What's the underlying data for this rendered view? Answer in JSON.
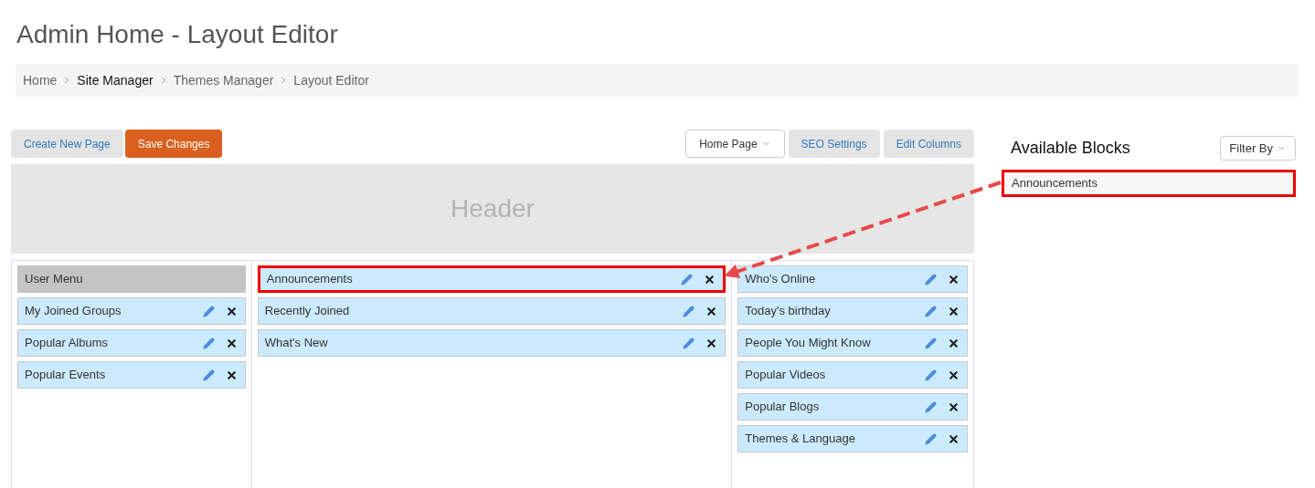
{
  "title": "Admin Home - Layout Editor",
  "breadcrumb": [
    {
      "label": "Home",
      "highlighted": false
    },
    {
      "label": "Site Manager",
      "highlighted": true
    },
    {
      "label": "Themes Manager",
      "highlighted": false
    },
    {
      "label": "Layout Editor",
      "highlighted": false
    }
  ],
  "toolbar": {
    "left": [
      {
        "label": "Create New Page",
        "kind": "plain"
      },
      {
        "label": "Save Changes",
        "kind": "primary"
      }
    ],
    "right": [
      {
        "label": "Home Page",
        "kind": "dropdown"
      },
      {
        "label": "SEO Settings",
        "kind": "plain"
      },
      {
        "label": "Edit Columns",
        "kind": "plain"
      }
    ]
  },
  "header": {
    "label": "Header"
  },
  "columns": [
    {
      "blocks": [
        {
          "label": "User Menu",
          "kind": "fixed",
          "highlighted": false
        },
        {
          "label": "My Joined Groups",
          "kind": "block",
          "highlighted": false
        },
        {
          "label": "Popular Albums",
          "kind": "block",
          "highlighted": false
        },
        {
          "label": "Popular Events",
          "kind": "block",
          "highlighted": false
        }
      ]
    },
    {
      "blocks": [
        {
          "label": "Announcements",
          "kind": "block",
          "highlighted": true
        },
        {
          "label": "Recently Joined",
          "kind": "block",
          "highlighted": false
        },
        {
          "label": "What's New",
          "kind": "block",
          "highlighted": false
        }
      ]
    },
    {
      "blocks": [
        {
          "label": "Who's Online",
          "kind": "block",
          "highlighted": false
        },
        {
          "label": "Today's birthday",
          "kind": "block",
          "highlighted": false
        },
        {
          "label": "People You Might Know",
          "kind": "block",
          "highlighted": false
        },
        {
          "label": "Popular Videos",
          "kind": "block",
          "highlighted": false
        },
        {
          "label": "Popular Blogs",
          "kind": "block",
          "highlighted": false
        },
        {
          "label": "Themes & Language",
          "kind": "block",
          "highlighted": false
        }
      ]
    }
  ],
  "available_blocks": {
    "title": "Available Blocks",
    "filter": "Filter By",
    "items": [
      {
        "label": "Announcements",
        "highlighted": true
      }
    ]
  }
}
